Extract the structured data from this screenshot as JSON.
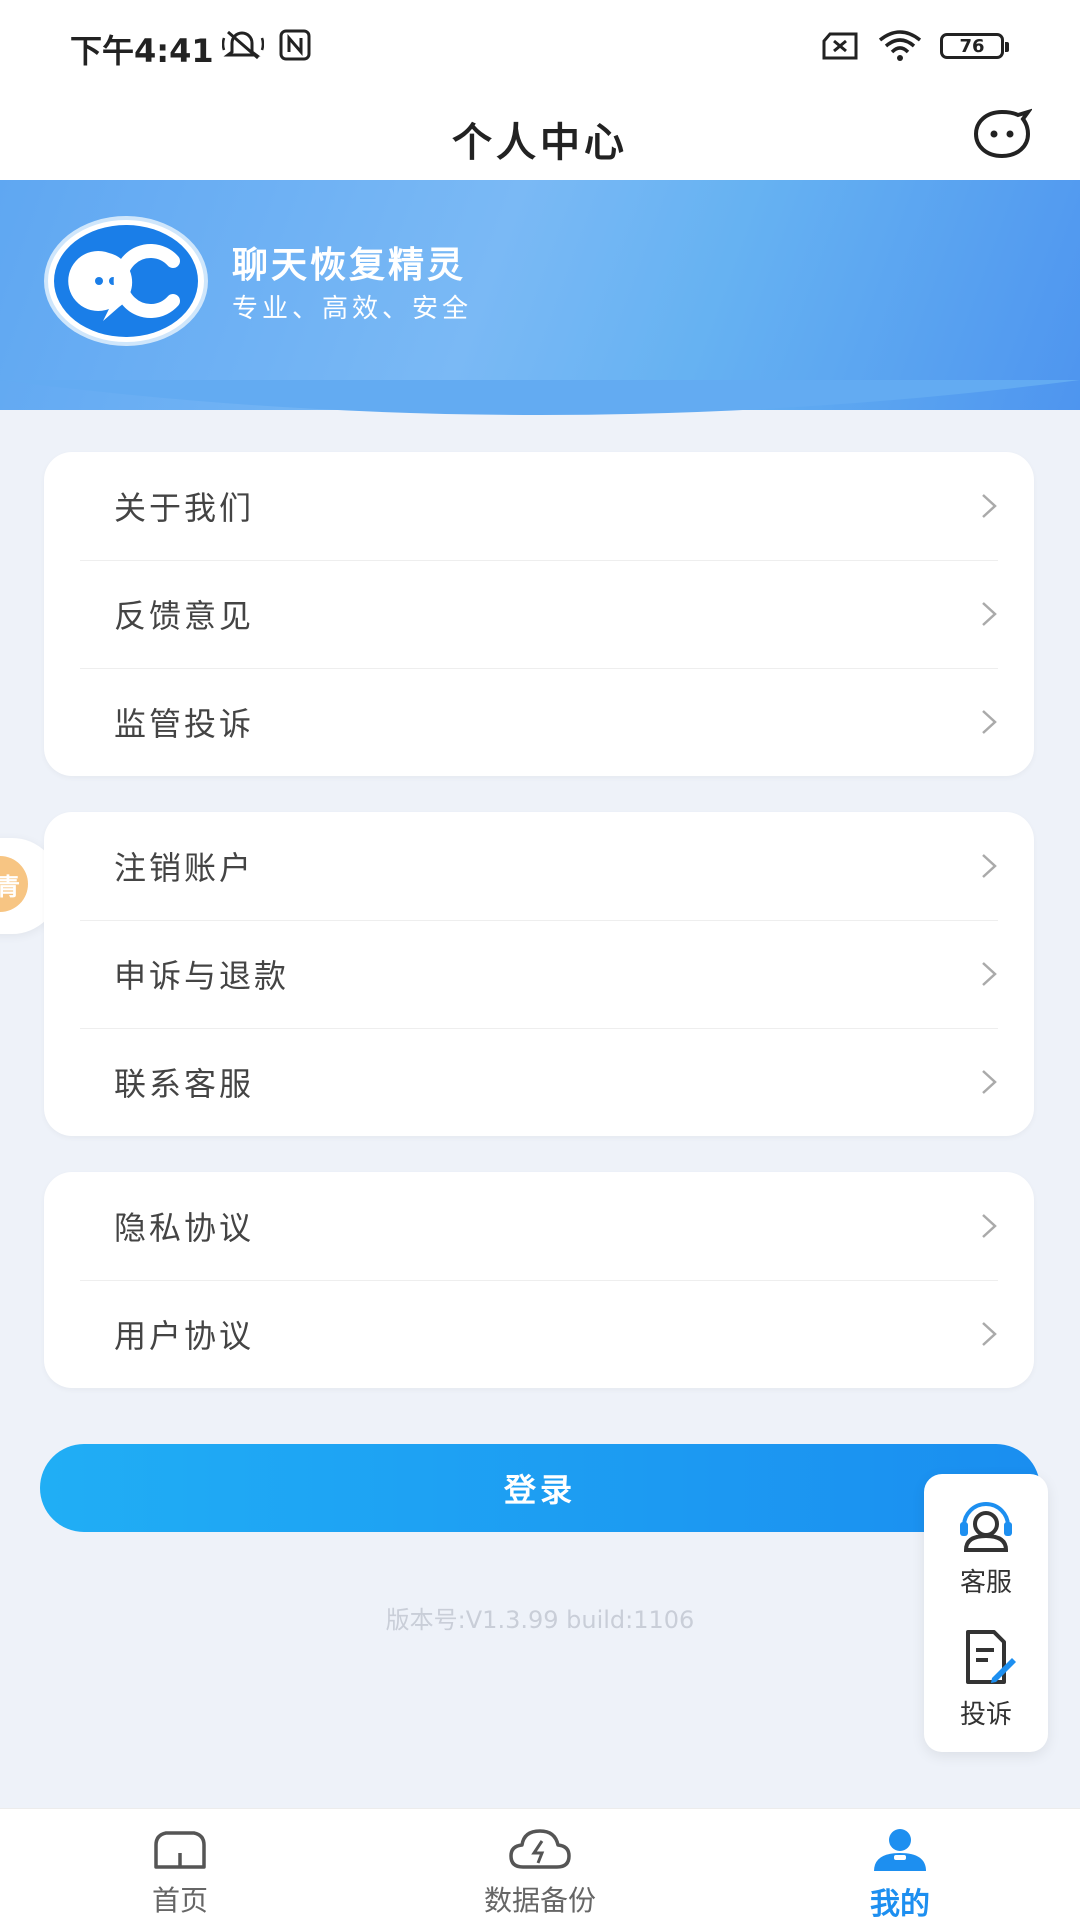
{
  "status_bar": {
    "time": "下午4:41",
    "battery": "76"
  },
  "header": {
    "title": "个人中心"
  },
  "profile": {
    "app_name": "聊天恢复精灵",
    "slogan": "专业、高效、安全"
  },
  "menu_groups": [
    [
      {
        "label": "关于我们"
      },
      {
        "label": "反馈意见"
      },
      {
        "label": "监管投诉"
      }
    ],
    [
      {
        "label": "注销账户"
      },
      {
        "label": "申诉与退款"
      },
      {
        "label": "联系客服"
      }
    ],
    [
      {
        "label": "隐私协议"
      },
      {
        "label": "用户协议"
      }
    ]
  ],
  "side_tab": {
    "label": "青"
  },
  "login_label": "登录",
  "version": "版本号:V1.3.99 build:1106",
  "float_panel": {
    "service_label": "客服",
    "complaint_label": "投诉"
  },
  "bottom_nav": [
    {
      "label": "首页",
      "icon": "home-icon"
    },
    {
      "label": "数据备份",
      "icon": "cloud-backup-icon"
    },
    {
      "label": "我的",
      "icon": "user-icon",
      "active": true
    }
  ],
  "colors": {
    "accent": "#1d8ff0",
    "banner": "#66b2f2",
    "background": "#eef2f9"
  }
}
